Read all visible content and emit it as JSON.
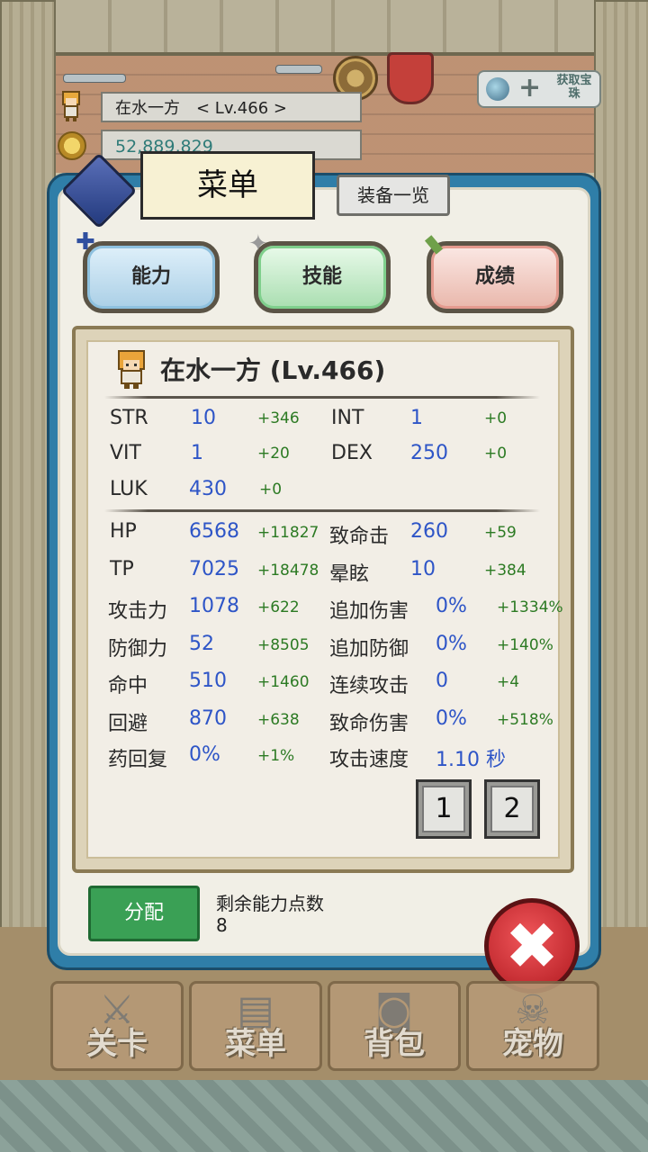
{
  "hud": {
    "player_name": "在水一方　< Lv.466 >",
    "gold": "52,889,829",
    "get_button_text": "获取宝珠"
  },
  "panel": {
    "title": "菜单",
    "equip_list_button": "装备一览",
    "tabs": [
      {
        "label": "能力",
        "icon": "person-plus-icon"
      },
      {
        "label": "技能",
        "icon": "sparkle-icon"
      },
      {
        "label": "成绩",
        "icon": "scroll-icon"
      }
    ]
  },
  "character": {
    "title": "在水一方 (Lv.466)"
  },
  "base_stats": [
    {
      "name": "STR",
      "value": "10",
      "bonus": "+346"
    },
    {
      "name": "INT",
      "value": "1",
      "bonus": "+0"
    },
    {
      "name": "VIT",
      "value": "1",
      "bonus": "+20"
    },
    {
      "name": "DEX",
      "value": "250",
      "bonus": "+0"
    },
    {
      "name": "LUK",
      "value": "430",
      "bonus": "+0"
    }
  ],
  "derived_left": [
    {
      "name": "HP",
      "value": "6568",
      "bonus": "+11827"
    },
    {
      "name": "TP",
      "value": "7025",
      "bonus": "+18478"
    },
    {
      "name": "攻击力",
      "value": "1078",
      "bonus": "+622"
    },
    {
      "name": "防御力",
      "value": "52",
      "bonus": "+8505"
    },
    {
      "name": "命中",
      "value": "510",
      "bonus": "+1460"
    },
    {
      "name": "回避",
      "value": "870",
      "bonus": "+638"
    },
    {
      "name": "药回复",
      "value": "0%",
      "bonus": "+1%"
    }
  ],
  "derived_right": [
    {
      "name": "致命击",
      "value": "260",
      "bonus": "+59"
    },
    {
      "name": "晕眩",
      "value": "10",
      "bonus": "+384"
    },
    {
      "name": "追加伤害",
      "value": "0%",
      "bonus": "+1334%"
    },
    {
      "name": "追加防御",
      "value": "0%",
      "bonus": "+140%"
    },
    {
      "name": "连续攻击",
      "value": "0",
      "bonus": "+4"
    },
    {
      "name": "致命伤害",
      "value": "0%",
      "bonus": "+518%"
    },
    {
      "name": "攻击速度",
      "value": "1.10 秒",
      "bonus": ""
    }
  ],
  "pages": [
    "1",
    "2"
  ],
  "footer": {
    "assign_button": "分配",
    "remaining_label": "剩余能力点数",
    "remaining_value": "8"
  },
  "bottom_nav": [
    {
      "label": "关卡",
      "icon": "crossed-swords-icon"
    },
    {
      "label": "菜单",
      "icon": "book-icon"
    },
    {
      "label": "背包",
      "icon": "backpack-icon"
    },
    {
      "label": "宠物",
      "icon": "skull-icon"
    }
  ],
  "colors": {
    "stat_value": "#2e55c7",
    "stat_bonus": "#2c7a23",
    "panel_frame": "#2f7ea8",
    "close_button": "#d7262c",
    "assign_button": "#3aa055"
  }
}
